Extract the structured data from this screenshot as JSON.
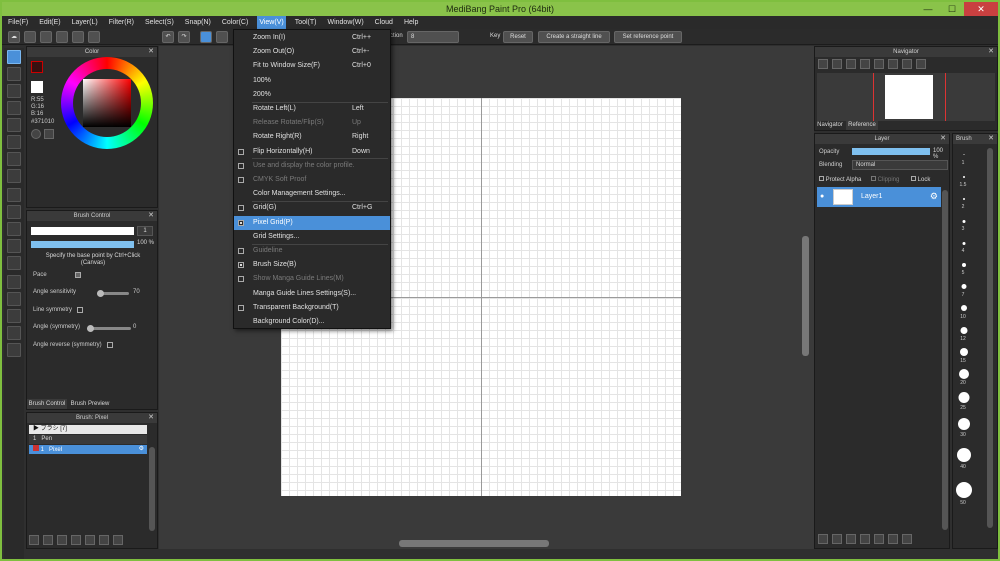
{
  "window": {
    "title": "MediBang Paint Pro (64bit)",
    "controls": [
      "—",
      "☐",
      "✕"
    ]
  },
  "menubar": [
    "File(F)",
    "Edit(E)",
    "Layer(L)",
    "Filter(R)",
    "Select(S)",
    "Snap(N)",
    "Color(C)",
    "View(V)",
    "Tool(T)",
    "Window(W)",
    "Cloud",
    "Help"
  ],
  "toolbar": {
    "correction_label": "ction",
    "correction_value": "8",
    "key_label": "Key",
    "reset_label": "Reset",
    "straight_line_label": "Create a straight line",
    "reference_point_label": "Set reference point"
  },
  "view_menu": {
    "items": [
      {
        "label": "Zoom In(I)",
        "shortcut": "Ctrl++",
        "check": "none",
        "state": "enabled"
      },
      {
        "label": "Zoom Out(O)",
        "shortcut": "Ctrl+-",
        "check": "none",
        "state": "enabled"
      },
      {
        "label": "Fit to Window Size(F)",
        "shortcut": "Ctrl+0",
        "check": "none",
        "state": "enabled"
      },
      {
        "label": "100%",
        "shortcut": "",
        "check": "none",
        "state": "enabled"
      },
      {
        "label": "200%",
        "shortcut": "",
        "check": "none",
        "state": "enabled"
      },
      {
        "label": "Rotate Left(L)",
        "shortcut": "Left",
        "check": "none",
        "state": "enabled"
      },
      {
        "label": "Release Rotate/Flip(S)",
        "shortcut": "Up",
        "check": "none",
        "state": "disabled"
      },
      {
        "label": "Rotate Right(R)",
        "shortcut": "Right",
        "check": "none",
        "state": "enabled"
      },
      {
        "label": "Flip Horizontally(H)",
        "shortcut": "Down",
        "check": "box",
        "state": "enabled"
      },
      {
        "label": "Use and display the color profile.",
        "shortcut": "",
        "check": "box",
        "state": "disabled"
      },
      {
        "label": "CMYK Soft Proof",
        "shortcut": "",
        "check": "box",
        "state": "disabled"
      },
      {
        "label": "Color Management Settings...",
        "shortcut": "",
        "check": "none",
        "state": "enabled"
      },
      {
        "label": "Grid(G)",
        "shortcut": "Ctrl+G",
        "check": "box",
        "state": "enabled"
      },
      {
        "label": "Pixel Grid(P)",
        "shortcut": "",
        "check": "checked",
        "state": "highlighted"
      },
      {
        "label": "Grid Settings...",
        "shortcut": "",
        "check": "none",
        "state": "enabled"
      },
      {
        "label": "Guideline",
        "shortcut": "",
        "check": "box",
        "state": "disabled"
      },
      {
        "label": "Brush Size(B)",
        "shortcut": "",
        "check": "checked",
        "state": "enabled"
      },
      {
        "label": "Show Manga Guide Lines(M)",
        "shortcut": "",
        "check": "box",
        "state": "disabled"
      },
      {
        "label": "Manga Guide Lines Settings(S)...",
        "shortcut": "",
        "check": "none",
        "state": "enabled"
      },
      {
        "label": "Transparent Background(T)",
        "shortcut": "",
        "check": "box",
        "state": "enabled"
      },
      {
        "label": "Background Color(D)...",
        "shortcut": "",
        "check": "none",
        "state": "enabled"
      }
    ]
  },
  "color_panel": {
    "title": "Color",
    "r": "R:55",
    "g": "G:16",
    "b": "B:16",
    "hex": "#371010",
    "fg_color": "#371010",
    "bg_color": "#ffffff"
  },
  "brush_control": {
    "title": "Brush Control",
    "size_value": "1",
    "opacity_value": "100 %",
    "hint": "Specify the base point by Ctrl+Click (Canvas)",
    "pace_label": "Pace",
    "angle_sensitivity_label": "Angle sensitivity",
    "angle_sensitivity_value": "70",
    "line_symmetry_label": "Line symmetry",
    "angle_symmetry_label": "Angle (symmetry)",
    "angle_symmetry_value": "0",
    "angle_reverse_label": "Angle reverse (symmetry)",
    "tabs": [
      "Brush Control",
      "Brush Preview"
    ]
  },
  "brush_list": {
    "title": "Brush: Pixel",
    "group": "ブラシ [7]",
    "items": [
      {
        "size": "1",
        "name": "Pen"
      },
      {
        "size": "1",
        "name": "Pixel"
      }
    ]
  },
  "navigator": {
    "title": "Navigator",
    "tabs": [
      "Navigator",
      "Reference"
    ]
  },
  "layer_panel": {
    "title": "Layer",
    "opacity_label": "Opacity",
    "opacity_value": "100 %",
    "blending_label": "Blending",
    "blending_value": "Normal",
    "protect_alpha_label": "Protect Alpha",
    "clipping_label": "Clipping",
    "lock_label": "Lock",
    "layers": [
      "Layer1"
    ]
  },
  "brush_size_panel": {
    "title": "Brush",
    "sizes": [
      "1",
      "1.5",
      "2",
      "3",
      "4",
      "5",
      "7",
      "10",
      "12",
      "15",
      "20",
      "25",
      "30",
      "40",
      "50"
    ]
  },
  "colors": {
    "accent": "#4a90d9",
    "titlebar": "#8ac34a"
  }
}
